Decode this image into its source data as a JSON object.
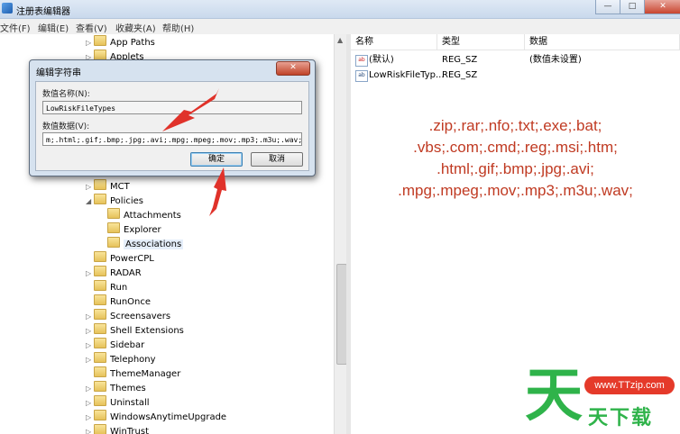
{
  "window": {
    "title": "注册表编辑器",
    "controls": [
      "—",
      "□",
      "✕"
    ]
  },
  "menu": [
    "文件(F)",
    "编辑(E)",
    "查看(V)",
    "收藏夹(A)",
    "帮助(H)"
  ],
  "tree": [
    {
      "label": "App Paths",
      "expander": "▷"
    },
    {
      "label": "Applets",
      "expander": "▷"
    },
    {
      "label": "MCT",
      "expander": "▷"
    },
    {
      "label": "Policies",
      "expander": "◢"
    },
    {
      "label": "Attachments",
      "expander": ""
    },
    {
      "label": "Explorer",
      "expander": ""
    },
    {
      "label": "Associations",
      "expander": ""
    },
    {
      "label": "PowerCPL",
      "expander": ""
    },
    {
      "label": "RADAR",
      "expander": "▷"
    },
    {
      "label": "Run",
      "expander": ""
    },
    {
      "label": "RunOnce",
      "expander": ""
    },
    {
      "label": "Screensavers",
      "expander": "▷"
    },
    {
      "label": "Shell Extensions",
      "expander": "▷"
    },
    {
      "label": "Sidebar",
      "expander": "▷"
    },
    {
      "label": "Telephony",
      "expander": "▷"
    },
    {
      "label": "ThemeManager",
      "expander": ""
    },
    {
      "label": "Themes",
      "expander": "▷"
    },
    {
      "label": "Uninstall",
      "expander": "▷"
    },
    {
      "label": "WindowsAnytimeUpgrade",
      "expander": "▷"
    },
    {
      "label": "WinTrust",
      "expander": "▷"
    }
  ],
  "values": {
    "headers": [
      "名称",
      "类型",
      "数据"
    ],
    "rows": [
      {
        "icon": "ab",
        "name": "(默认)",
        "type": "REG_SZ",
        "data": "(数值未设置)"
      },
      {
        "icon": "ab",
        "name": "LowRiskFileTyp...",
        "type": "REG_SZ",
        "data": ""
      }
    ]
  },
  "overlay_lines": [
    ".zip;.rar;.nfo;.txt;.exe;.bat;",
    ".vbs;.com;.cmd;.reg;.msi;.htm;",
    ".html;.gif;.bmp;.jpg;.avi;",
    ".mpg;.mpeg;.mov;.mp3;.m3u;.wav;"
  ],
  "dialog": {
    "title": "编辑字符串",
    "close": "✕",
    "name_label": "数值名称(N):",
    "name_value": "LowRiskFileTypes",
    "data_label": "数值数据(V):",
    "data_value": "m;.html;.gif;.bmp;.jpg;.avi;.mpg;.mpeg;.mov;.mp3;.m3u;.wav;",
    "ok": "确定",
    "cancel": "取消"
  },
  "watermark": {
    "badge": "www.TTzip.com",
    "big": "天",
    "sub": "天下载"
  },
  "colors": {
    "overlay_text": "#c03a22",
    "arrow": "#e0322a",
    "watermark_green": "#2fb34a"
  }
}
